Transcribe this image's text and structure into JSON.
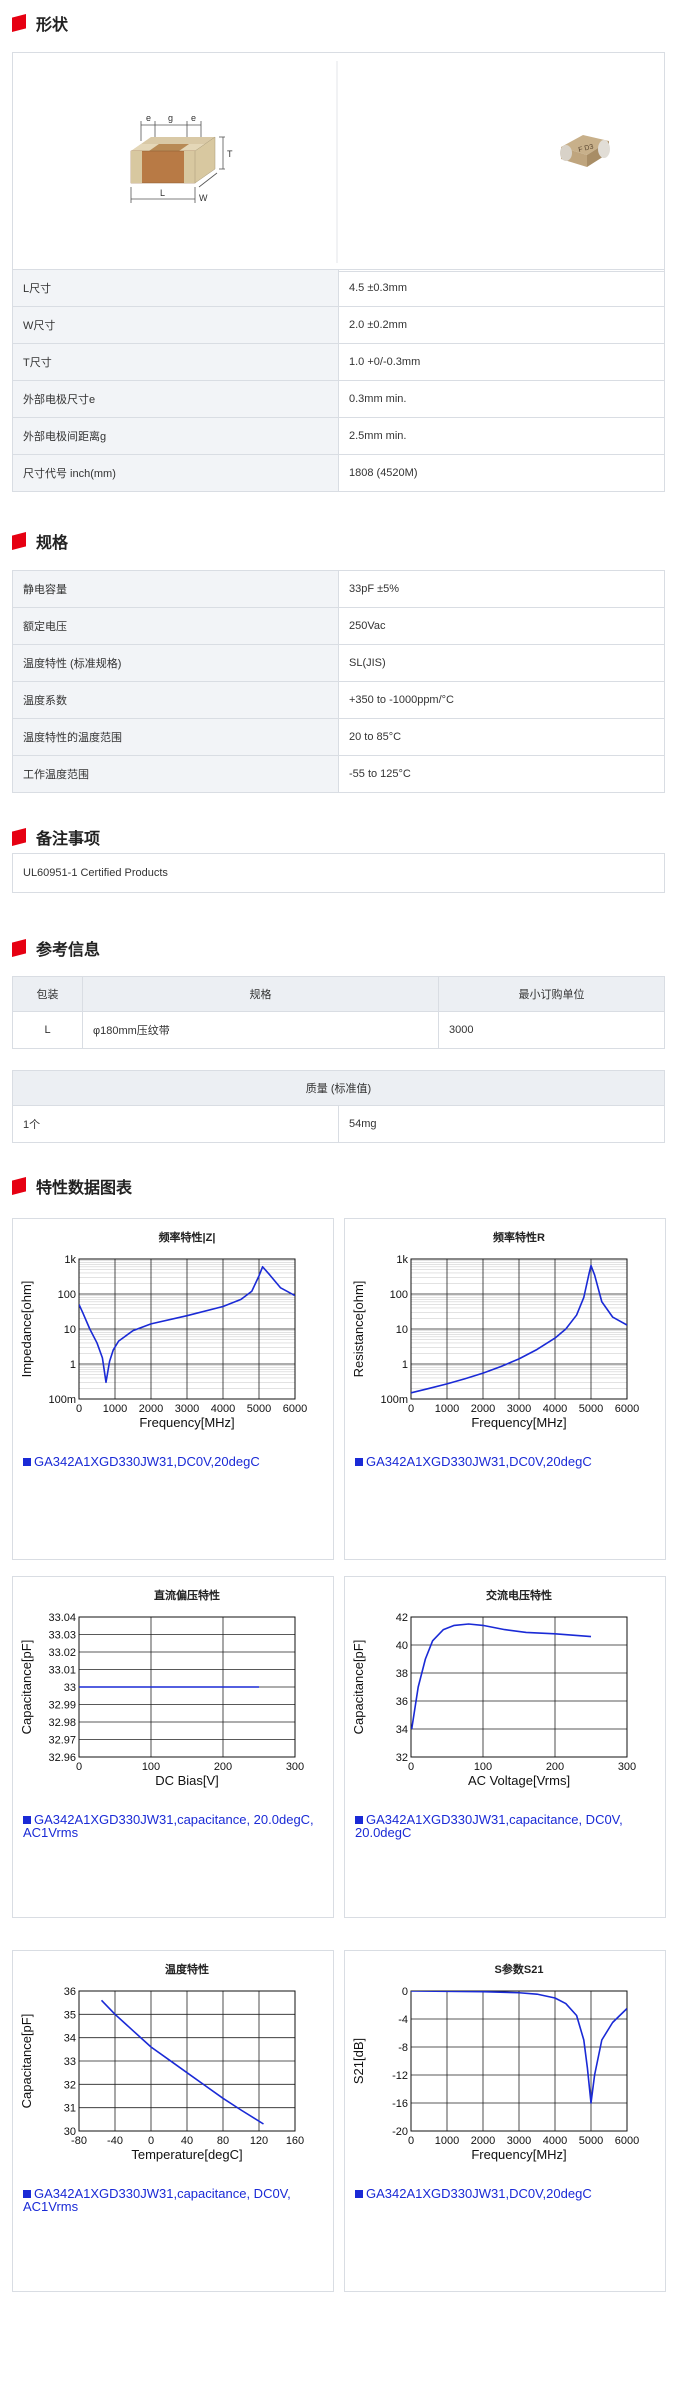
{
  "sections": {
    "shape": "形状",
    "spec": "规格",
    "remarks": "备注事项",
    "reference": "参考信息",
    "charts": "特性数据图表"
  },
  "shape_drawing_labels": {
    "e": "e",
    "g": "g",
    "t": "T",
    "l": "L",
    "w": "W"
  },
  "dimensions": [
    {
      "k": "L尺寸",
      "v": "4.5 ±0.3mm"
    },
    {
      "k": "W尺寸",
      "v": "2.0 ±0.2mm"
    },
    {
      "k": "T尺寸",
      "v": "1.0 +0/-0.3mm"
    },
    {
      "k": "外部电极尺寸e",
      "v": "0.3mm min."
    },
    {
      "k": "外部电极间距离g",
      "v": "2.5mm min."
    },
    {
      "k": "尺寸代号 inch(mm)",
      "v": "1808 (4520M)"
    }
  ],
  "specs": [
    {
      "k": "静电容量",
      "v": "33pF ±5%"
    },
    {
      "k": "额定电压",
      "v": "250Vac"
    },
    {
      "k": "温度特性 (标准规格)",
      "v": "SL(JIS)"
    },
    {
      "k": "温度系数",
      "v": "+350 to -1000ppm/°C"
    },
    {
      "k": "温度特性的温度范围",
      "v": "20 to 85°C"
    },
    {
      "k": "工作温度范围",
      "v": "-55 to 125°C"
    }
  ],
  "remarks_text": "UL60951-1 Certified Products",
  "packaging": {
    "headers": [
      "包装",
      "规格",
      "最小订购单位"
    ],
    "row": [
      "L",
      "φ180mm压纹带",
      "3000"
    ]
  },
  "mass": {
    "header": "质量 (标准值)",
    "row": [
      "1个",
      "54mg"
    ]
  },
  "chart_data": [
    {
      "type": "line",
      "title": "频率特性|Z|",
      "xlabel": "Frequency[MHz]",
      "ylabel": "Impedance[ohm]",
      "xlim": [
        0,
        6000
      ],
      "ylim": [
        0.1,
        1000
      ],
      "yscale": "log",
      "xticks": [
        "0",
        "1000",
        "2000",
        "3000",
        "4000",
        "5000",
        "6000"
      ],
      "yticks": [
        "100m",
        "1",
        "10",
        "100",
        "1k"
      ],
      "series": [
        {
          "x": [
            1,
            100,
            300,
            500,
            650,
            750,
            800,
            850,
            950,
            1100,
            1500,
            2000,
            3000,
            4000,
            4500,
            4800,
            5000,
            5100,
            5300,
            5600,
            6000
          ],
          "y": [
            50,
            30,
            10,
            4,
            1.5,
            0.3,
            0.6,
            1.2,
            2.5,
            4.5,
            9,
            14,
            24,
            44,
            70,
            120,
            330,
            600,
            350,
            150,
            90
          ]
        }
      ],
      "legend": "GA342A1XGD330JW31,DC0V,20degC"
    },
    {
      "type": "line",
      "title": "频率特性R",
      "xlabel": "Frequency[MHz]",
      "ylabel": "Resistance[ohm]",
      "xlim": [
        0,
        6000
      ],
      "ylim": [
        0.1,
        1000
      ],
      "yscale": "log",
      "xticks": [
        "0",
        "1000",
        "2000",
        "3000",
        "4000",
        "5000",
        "6000"
      ],
      "yticks": [
        "100m",
        "1",
        "10",
        "100",
        "1k"
      ],
      "series": [
        {
          "x": [
            1,
            500,
            1000,
            1500,
            2000,
            2500,
            3000,
            3500,
            4000,
            4300,
            4600,
            4800,
            4950,
            5000,
            5100,
            5300,
            5600,
            6000
          ],
          "y": [
            0.15,
            0.2,
            0.27,
            0.38,
            0.55,
            0.85,
            1.4,
            2.6,
            5.5,
            10,
            25,
            80,
            400,
            650,
            350,
            60,
            22,
            13
          ]
        }
      ],
      "legend": "GA342A1XGD330JW31,DC0V,20degC"
    },
    {
      "type": "line",
      "title": "直流偏压特性",
      "xlabel": "DC Bias[V]",
      "ylabel": "Capacitance[pF]",
      "xlim": [
        0,
        300
      ],
      "ylim": [
        32.96,
        33.04
      ],
      "xticks": [
        "0",
        "100",
        "200",
        "300"
      ],
      "yticks": [
        "32.96",
        "32.97",
        "32.98",
        "32.99",
        "33",
        "33.01",
        "33.02",
        "33.03",
        "33.04"
      ],
      "series": [
        {
          "x": [
            0,
            50,
            100,
            150,
            200,
            250
          ],
          "y": [
            33,
            33,
            33,
            33,
            33,
            33
          ]
        }
      ],
      "legend": "GA342A1XGD330JW31,capacitance, 20.0degC, AC1Vrms"
    },
    {
      "type": "line",
      "title": "交流电压特性",
      "xlabel": "AC Voltage[Vrms]",
      "ylabel": "Capacitance[pF]",
      "xlim": [
        0,
        300
      ],
      "ylim": [
        32,
        42
      ],
      "xticks": [
        "0",
        "100",
        "200",
        "300"
      ],
      "yticks": [
        "32",
        "34",
        "36",
        "38",
        "40",
        "42"
      ],
      "series": [
        {
          "x": [
            1,
            10,
            20,
            30,
            45,
            60,
            80,
            100,
            130,
            160,
            200,
            250
          ],
          "y": [
            34,
            37,
            39,
            40.3,
            41.1,
            41.4,
            41.5,
            41.4,
            41.1,
            40.9,
            40.8,
            40.6
          ]
        }
      ],
      "legend": "GA342A1XGD330JW31,capacitance, DC0V, 20.0degC"
    },
    {
      "type": "line",
      "title": "温度特性",
      "xlabel": "Temperature[degC]",
      "ylabel": "Capacitance[pF]",
      "xlim": [
        -80,
        160
      ],
      "ylim": [
        30,
        36
      ],
      "xticks": [
        "-80",
        "-40",
        "0",
        "40",
        "80",
        "120",
        "160"
      ],
      "yticks": [
        "30",
        "31",
        "32",
        "33",
        "34",
        "35",
        "36"
      ],
      "series": [
        {
          "x": [
            -55,
            -40,
            -20,
            0,
            20,
            40,
            60,
            80,
            100,
            125
          ],
          "y": [
            35.6,
            35.0,
            34.3,
            33.6,
            33.05,
            32.5,
            31.95,
            31.4,
            30.9,
            30.3
          ]
        }
      ],
      "legend": "GA342A1XGD330JW31,capacitance, DC0V, AC1Vrms"
    },
    {
      "type": "line",
      "title": "S参数S21",
      "xlabel": "Frequency[MHz]",
      "ylabel": "S21[dB]",
      "xlim": [
        0,
        6000
      ],
      "ylim": [
        -20,
        0
      ],
      "xticks": [
        "0",
        "1000",
        "2000",
        "3000",
        "4000",
        "5000",
        "6000"
      ],
      "yticks": [
        "-20",
        "-16",
        "-12",
        "-8",
        "-4",
        "0"
      ],
      "series": [
        {
          "x": [
            0,
            1000,
            2000,
            3000,
            3500,
            4000,
            4300,
            4600,
            4800,
            4900,
            5000,
            5100,
            5300,
            5600,
            6000
          ],
          "y": [
            0,
            -0.05,
            -0.1,
            -0.25,
            -0.45,
            -1,
            -1.8,
            -3.5,
            -7,
            -11,
            -16,
            -12,
            -7,
            -4.5,
            -2.5
          ]
        }
      ],
      "legend": "GA342A1XGD330JW31,DC0V,20degC"
    }
  ],
  "colors": {
    "accent": "#e60012",
    "line": "#1a2ad6"
  }
}
